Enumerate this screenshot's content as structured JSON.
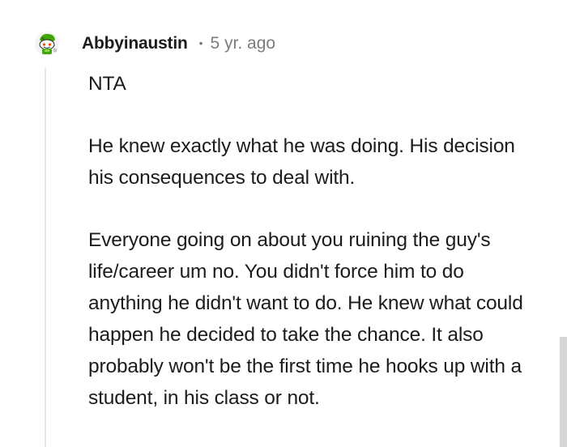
{
  "comment": {
    "avatar_icon": "reddit-snoo-avatar-icon",
    "username": "Abbyinaustin",
    "separator": "•",
    "timestamp": "5 yr. ago",
    "paragraphs": [
      "NTA",
      "He knew exactly what he was doing. His decision his consequences to deal with.",
      "Everyone going on about you ruining the guy's life/career um no. You didn't force him to do anything he didn't want to do. He knew what could happen he decided to take the chance. It also probably won't be the first time he hooks up with a student, in his class or not."
    ]
  },
  "colors": {
    "text": "#1c1c1c",
    "meta": "#7c7c7c",
    "thread_line": "#e4e6e8",
    "scrollbar": "#d6d6d6",
    "avatar_green": "#46a508"
  }
}
